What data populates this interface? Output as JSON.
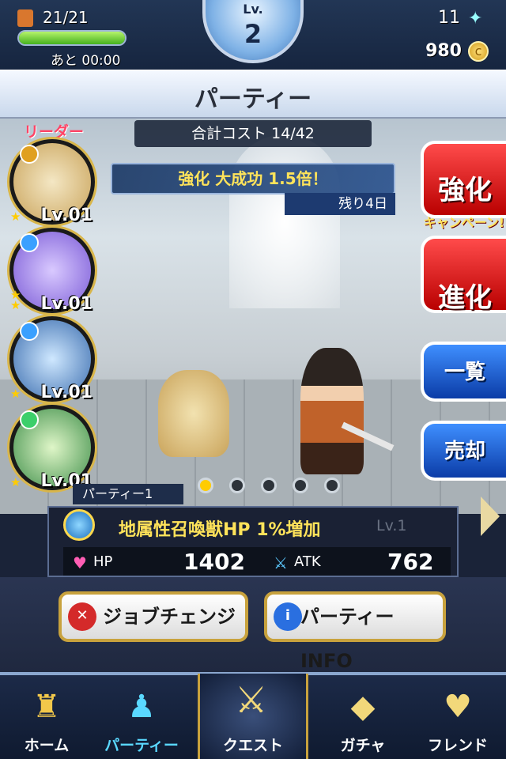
{
  "status": {
    "stamina": "21/21",
    "stamina_fraction": 1.0,
    "timer": "あと 00:00",
    "level_label": "Lv.",
    "level": "2",
    "gems": "11",
    "coins": "980"
  },
  "header": {
    "title": "パーティー"
  },
  "party": {
    "cost": "合計コスト 14/42",
    "leader_label": "リーダー",
    "campaign_text": "強化 大成功 1.5倍！",
    "remaining": "残り4日",
    "slots": [
      {
        "level": "Lv.01",
        "stars": 1,
        "attr_color": "#e0a020"
      },
      {
        "level": "Lv.01",
        "stars": 2,
        "attr_color": "#3aa0ff"
      },
      {
        "level": "Lv.01",
        "stars": 1,
        "attr_color": "#3aa0ff"
      },
      {
        "level": "Lv.01",
        "stars": 1,
        "attr_color": "#3ccf6a"
      }
    ],
    "page_total": 5,
    "page_active": 1,
    "party_name": "パーティー1"
  },
  "side_buttons": {
    "enhance": "強化",
    "campaign_tag": "キャンペーン!",
    "evolve": "進化",
    "list": "一覧",
    "sell": "売却"
  },
  "info": {
    "skill": "地属性召喚獣HP 1%増加",
    "skill_level": "Lv.1",
    "hp_label": "HP",
    "hp_value": "1402",
    "atk_label": "ATK",
    "atk_value": "762"
  },
  "actions": {
    "job_change": "ジョブチェンジ",
    "party_info": "パーティーINFO"
  },
  "nav": {
    "home": "ホーム",
    "party": "パーティー",
    "quest": "クエスト",
    "gacha": "ガチャ",
    "friend": "フレンド"
  },
  "colors": {
    "accent_gold": "#c8a23d",
    "campaign_yellow": "#ffe35a",
    "red_button": "#d41a1a",
    "blue_button": "#1e5fd6"
  }
}
